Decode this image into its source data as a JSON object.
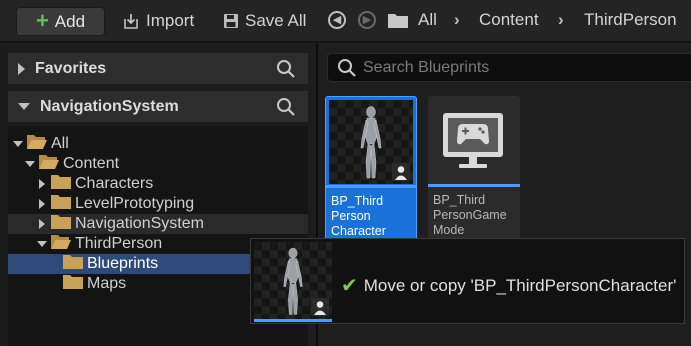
{
  "toolbar": {
    "add_label": "Add",
    "import_label": "Import",
    "save_all_label": "Save All",
    "breadcrumbs": [
      "All",
      "Content",
      "ThirdPerson"
    ]
  },
  "left_panel": {
    "favorites": {
      "label": "Favorites",
      "expanded": false
    },
    "navigation_system": {
      "label": "NavigationSystem",
      "expanded": true
    },
    "tree": [
      {
        "label": "All",
        "depth": 0,
        "expanded": true
      },
      {
        "label": "Content",
        "depth": 1,
        "expanded": true
      },
      {
        "label": "Characters",
        "depth": 2,
        "expanded": false
      },
      {
        "label": "LevelPrototyping",
        "depth": 2,
        "expanded": false
      },
      {
        "label": "NavigationSystem",
        "depth": 2,
        "expanded": false,
        "hover": true
      },
      {
        "label": "ThirdPerson",
        "depth": 2,
        "expanded": true
      },
      {
        "label": "Blueprints",
        "depth": 3,
        "selected": true
      },
      {
        "label": "Maps",
        "depth": 3
      }
    ]
  },
  "right_panel": {
    "search_placeholder": "Search Blueprints",
    "assets": [
      {
        "name": "BP_Third Person Character",
        "icon": "character-thumbnail",
        "selected": true
      },
      {
        "name": "BP_Third PersonGame Mode",
        "icon": "gamepad-monitor-icon",
        "selected": false
      }
    ]
  },
  "drag_tooltip": {
    "message": "Move or copy 'BP_ThirdPersonCharacter'",
    "icon": "check-icon"
  },
  "colors": {
    "accent": "#1a72d8",
    "selection": "#2d4a78",
    "folder": "#c8a25a",
    "check": "#7ec94a"
  }
}
